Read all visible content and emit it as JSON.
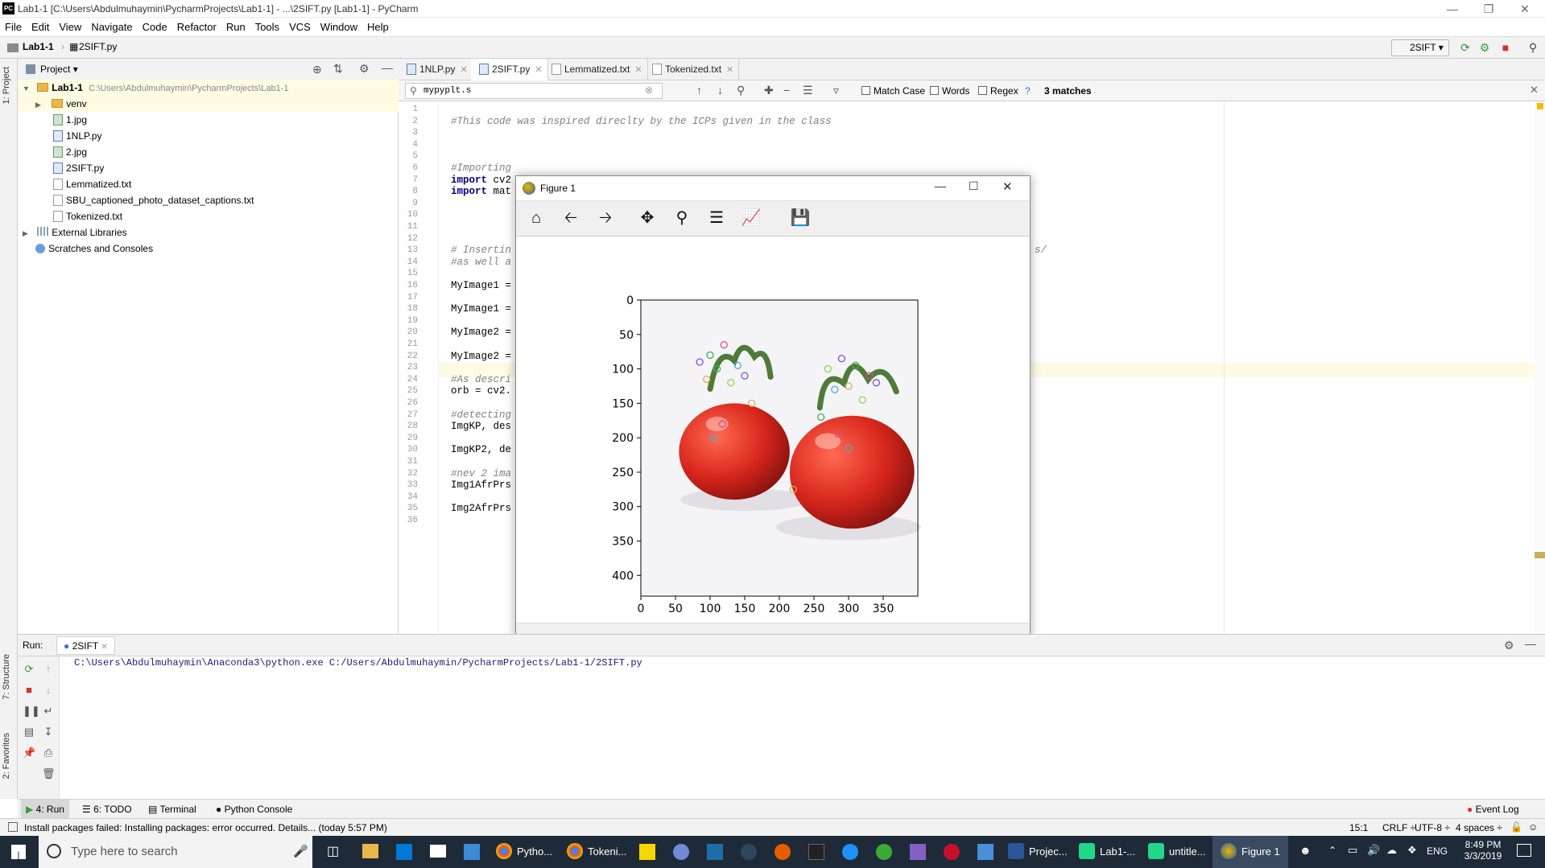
{
  "window": {
    "title": "Lab1-1 [C:\\Users\\Abdulmuhaymin\\PycharmProjects\\Lab1-1] - ...\\2SIFT.py [Lab1-1] - PyCharm",
    "logo": "PC"
  },
  "menu": [
    "File",
    "Edit",
    "View",
    "Navigate",
    "Code",
    "Refactor",
    "Run",
    "Tools",
    "VCS",
    "Window",
    "Help"
  ],
  "breadcrumb": {
    "project": "Lab1-1",
    "file": "2SIFT.py"
  },
  "run_config": "2SIFT",
  "sidebar_left": {
    "project_tab": "1: Project",
    "structure_tab": "7: Structure",
    "favorites_tab": "2: Favorites"
  },
  "project": {
    "header": "Project",
    "root": {
      "name": "Lab1-1",
      "path": "C:\\Users\\Abdulmuhaymin\\PycharmProjects\\Lab1-1"
    },
    "items": [
      {
        "name": "venv",
        "kind": "folder"
      },
      {
        "name": "1.jpg",
        "kind": "img"
      },
      {
        "name": "1NLP.py",
        "kind": "py"
      },
      {
        "name": "2.jpg",
        "kind": "img"
      },
      {
        "name": "2SIFT.py",
        "kind": "py"
      },
      {
        "name": "Lemmatized.txt",
        "kind": "txt"
      },
      {
        "name": "SBU_captioned_photo_dataset_captions.txt",
        "kind": "txt"
      },
      {
        "name": "Tokenized.txt",
        "kind": "txt"
      }
    ],
    "external": "External Libraries",
    "scratches": "Scratches and Consoles"
  },
  "tabs": [
    "1NLP.py",
    "2SIFT.py",
    "Lemmatized.txt",
    "Tokenized.txt"
  ],
  "find": {
    "query": "mypyplt.s",
    "match_case": "Match Case",
    "words": "Words",
    "regex": "Regex",
    "help": "?",
    "result": "3 matches"
  },
  "code_lines": [
    {
      "n": "1",
      "t": ""
    },
    {
      "n": "2",
      "t": "#This code was inspired direclty by the ICPs given in the class",
      "c": true
    },
    {
      "n": "3",
      "t": ""
    },
    {
      "n": "4",
      "t": ""
    },
    {
      "n": "5",
      "t": ""
    },
    {
      "n": "6",
      "t": "#Importing",
      "c": true
    },
    {
      "n": "7",
      "t": "import cv2"
    },
    {
      "n": "8",
      "t": "import mat"
    },
    {
      "n": "9",
      "t": ""
    },
    {
      "n": "10",
      "t": ""
    },
    {
      "n": "11",
      "t": ""
    },
    {
      "n": "12",
      "t": ""
    },
    {
      "n": "13",
      "t": "# Insertin",
      "c": true,
      "tail": "s/"
    },
    {
      "n": "14",
      "t": "#as well a",
      "c": true
    },
    {
      "n": "15",
      "t": ""
    },
    {
      "n": "16",
      "t": "MyImage1 ="
    },
    {
      "n": "17",
      "t": ""
    },
    {
      "n": "18",
      "t": "MyImage1 ="
    },
    {
      "n": "19",
      "t": ""
    },
    {
      "n": "20",
      "t": "MyImage2 ="
    },
    {
      "n": "21",
      "t": ""
    },
    {
      "n": "22",
      "t": "MyImage2 ="
    },
    {
      "n": "23",
      "t": ""
    },
    {
      "n": "24",
      "t": "#As descri",
      "c": true
    },
    {
      "n": "25",
      "t": "orb = cv2."
    },
    {
      "n": "26",
      "t": ""
    },
    {
      "n": "27",
      "t": "#detecting",
      "c": true
    },
    {
      "n": "28",
      "t": "ImgKP, des"
    },
    {
      "n": "29",
      "t": ""
    },
    {
      "n": "30",
      "t": "ImgKP2, de"
    },
    {
      "n": "31",
      "t": ""
    },
    {
      "n": "32",
      "t": "#nev 2 ima",
      "c": true
    },
    {
      "n": "33",
      "t": "Img1AfrPrs"
    },
    {
      "n": "34",
      "t": ""
    },
    {
      "n": "35",
      "t": "Img2AfrPrs"
    },
    {
      "n": "36",
      "t": ""
    }
  ],
  "figure": {
    "title": "Figure 1",
    "toolbar": [
      "home-icon",
      "back-icon",
      "forward-icon",
      "pan-icon",
      "zoom-icon",
      "subplots-icon",
      "edit-axes-icon",
      "save-icon"
    ]
  },
  "chart_data": {
    "type": "image",
    "xlim": [
      0,
      400
    ],
    "ylim": [
      430,
      0
    ],
    "xticks": [
      "0",
      "50",
      "100",
      "150",
      "200",
      "250",
      "300",
      "350"
    ],
    "yticks": [
      "0",
      "50",
      "100",
      "150",
      "200",
      "250",
      "300",
      "350",
      "400"
    ],
    "colors": {
      "tomato": "#d8261c",
      "stem": "#4f7a38",
      "background": "#f4f4f6"
    }
  },
  "run": {
    "label": "Run:",
    "config": "2SIFT",
    "output": "C:\\Users\\Abdulmuhaymin\\Anaconda3\\python.exe C:/Users/Abdulmuhaymin/PycharmProjects/Lab1-1/2SIFT.py"
  },
  "bottom_tabs": {
    "run": "4: Run",
    "todo": "6: TODO",
    "terminal": "Terminal",
    "console": "Python Console",
    "event_log": "Event Log"
  },
  "status": {
    "message": "Install packages failed: Installing packages: error occurred. Details... (today 5:57 PM)",
    "position": "15:1",
    "line_sep": "CRLF",
    "encoding": "UTF-8",
    "indent": "4 spaces"
  },
  "taskbar": {
    "search_placeholder": "Type here to search",
    "apps": [
      "Pytho...",
      "Tokeni...",
      "Projec...",
      "Lab1-...",
      "untitle...",
      "Figure 1"
    ],
    "lang": "ENG",
    "time": "8:49 PM",
    "date": "3/3/2019"
  }
}
